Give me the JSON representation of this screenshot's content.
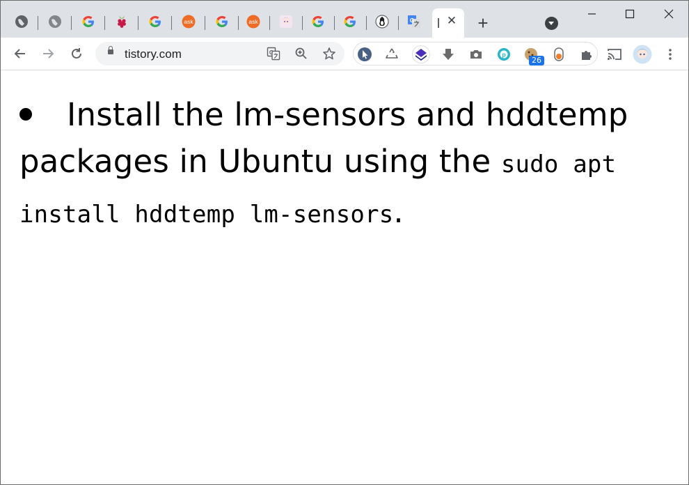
{
  "browser": {
    "address": "tistory.com",
    "active_tab_close": "✕",
    "new_tab": "+",
    "extension_badge": "26",
    "window_controls": {
      "minimize": "minimize-icon",
      "maximize": "maximize-icon",
      "close": "close-icon"
    },
    "tabs": [
      {
        "icon": "globe-icon"
      },
      {
        "icon": "globe-icon"
      },
      {
        "icon": "google-icon"
      },
      {
        "icon": "raspberry-icon"
      },
      {
        "icon": "google-icon"
      },
      {
        "icon": "ask-icon",
        "label": "ask"
      },
      {
        "icon": "google-icon"
      },
      {
        "icon": "ask-icon",
        "label": "ask"
      },
      {
        "icon": "anime-avatar-icon"
      },
      {
        "icon": "google-icon"
      },
      {
        "icon": "google-icon"
      },
      {
        "icon": "linux-tux-icon"
      },
      {
        "icon": "translate-icon"
      }
    ],
    "colors": {
      "tabstrip": "#dee1e6",
      "google_blue": "#4285f4",
      "ask_orange": "#ef6c26",
      "badge": "#1a73e8"
    }
  },
  "content": {
    "text_prefix": "Install the lm-sensors and hddtemp packages in Ubuntu using the ",
    "code": "sudo apt install hddtemp lm-sensors",
    "text_suffix": "."
  }
}
